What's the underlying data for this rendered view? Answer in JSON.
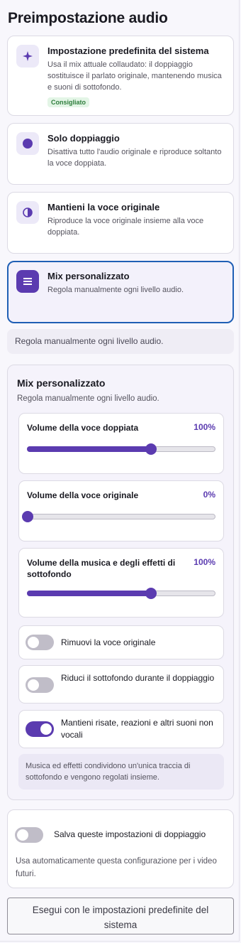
{
  "page_title": "Preimpostazione audio",
  "presets": [
    {
      "icon": "sparkle-icon",
      "title": "Impostazione predefinita del sistema",
      "description": "Usa il mix attuale collaudato: il doppiaggio sostituisce il parlato originale, mantenendo musica e suoni di sottofondo.",
      "badge": "Consigliato",
      "selected": false
    },
    {
      "icon": "dot-icon",
      "title": "Solo doppiaggio",
      "description": "Disattiva tutto l'audio originale e riproduce soltanto la voce doppiata.",
      "selected": false
    },
    {
      "icon": "half-circle-icon",
      "title": "Mantieni la voce originale",
      "description": "Riproduce la voce originale insieme alla voce doppiata.",
      "selected": false
    },
    {
      "icon": "sliders-icon",
      "title": "Mix personalizzato",
      "description": "Regola manualmente ogni livello audio.",
      "selected": true
    }
  ],
  "selected_note": "Regola manualmente ogni livello audio.",
  "custom_mix": {
    "title": "Mix personalizzato",
    "subtitle": "Regola manualmente ogni livello audio.",
    "sliders": [
      {
        "label": "Volume della voce doppiata",
        "value_text": "100%",
        "fraction": 0.66
      },
      {
        "label": "Volume della voce originale",
        "value_text": "0%",
        "fraction": 0.0
      },
      {
        "label": "Volume della musica e degli effetti di sottofondo",
        "value_text": "100%",
        "fraction": 0.66
      }
    ],
    "toggles": [
      {
        "label": "Rimuovi la voce originale",
        "on": false
      },
      {
        "label": "Riduci il sottofondo durante il doppiaggio",
        "on": false
      },
      {
        "label": "Mantieni risate, reazioni e altri suoni non vocali",
        "on": true
      }
    ],
    "note": "Musica ed effetti condividono un'unica traccia di sottofondo e vengono regolati insieme."
  },
  "save_settings": {
    "label": "Salva queste impostazioni di doppiaggio",
    "on": false,
    "description": "Usa automaticamente questa configurazione per i video futuri."
  },
  "run_button": "Esegui con le impostazioni predefinite del sistema",
  "colors": {
    "accent": "#5b3bb0",
    "selected_border": "#1f5fb5",
    "badge_bg": "#e3f5e6",
    "badge_text": "#2e7d3c"
  }
}
